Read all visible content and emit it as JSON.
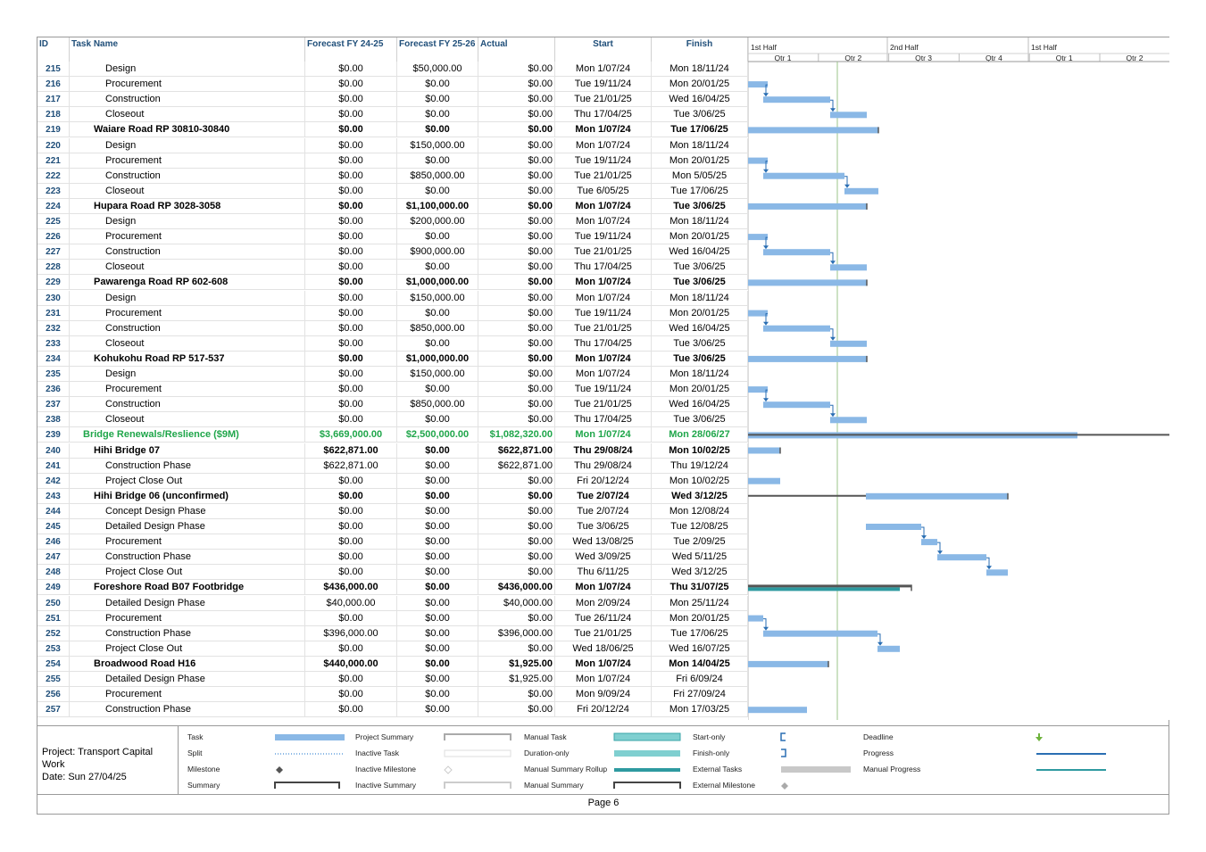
{
  "columns": {
    "id": "ID",
    "name": "Task Name",
    "f1": "Forecast FY 24-25",
    "f2": "Forecast FY 25-26",
    "actual": "Actual",
    "start": "Start",
    "finish": "Finish"
  },
  "timescale": {
    "tier1": [
      "1st Half",
      "2nd Half",
      "1st Half"
    ],
    "tier2": [
      "Qtr 1",
      "Qtr 2",
      "Qtr 3",
      "Qtr 4",
      "Qtr 1",
      "Qtr 2"
    ]
  },
  "rows": [
    {
      "id": "215",
      "name": "Design",
      "level": 2,
      "f1": "$0.00",
      "f2": "$50,000.00",
      "actual": "$0.00",
      "start": "Mon 1/07/24",
      "finish": "Mon 18/11/24"
    },
    {
      "id": "216",
      "name": "Procurement",
      "level": 2,
      "f1": "$0.00",
      "f2": "$0.00",
      "actual": "$0.00",
      "start": "Tue 19/11/24",
      "finish": "Mon 20/01/25"
    },
    {
      "id": "217",
      "name": "Construction",
      "level": 2,
      "f1": "$0.00",
      "f2": "$0.00",
      "actual": "$0.00",
      "start": "Tue 21/01/25",
      "finish": "Wed 16/04/25"
    },
    {
      "id": "218",
      "name": "Closeout",
      "level": 2,
      "f1": "$0.00",
      "f2": "$0.00",
      "actual": "$0.00",
      "start": "Thu 17/04/25",
      "finish": "Tue 3/06/25"
    },
    {
      "id": "219",
      "name": "Waiare Road RP 30810-30840",
      "level": 1,
      "f1": "$0.00",
      "f2": "$0.00",
      "actual": "$0.00",
      "start": "Mon 1/07/24",
      "finish": "Tue 17/06/25"
    },
    {
      "id": "220",
      "name": "Design",
      "level": 2,
      "f1": "$0.00",
      "f2": "$150,000.00",
      "actual": "$0.00",
      "start": "Mon 1/07/24",
      "finish": "Mon 18/11/24"
    },
    {
      "id": "221",
      "name": "Procurement",
      "level": 2,
      "f1": "$0.00",
      "f2": "$0.00",
      "actual": "$0.00",
      "start": "Tue 19/11/24",
      "finish": "Mon 20/01/25"
    },
    {
      "id": "222",
      "name": "Construction",
      "level": 2,
      "f1": "$0.00",
      "f2": "$850,000.00",
      "actual": "$0.00",
      "start": "Tue 21/01/25",
      "finish": "Mon 5/05/25"
    },
    {
      "id": "223",
      "name": "Closeout",
      "level": 2,
      "f1": "$0.00",
      "f2": "$0.00",
      "actual": "$0.00",
      "start": "Tue 6/05/25",
      "finish": "Tue 17/06/25"
    },
    {
      "id": "224",
      "name": "Hupara Road RP 3028-3058",
      "level": 1,
      "f1": "$0.00",
      "f2": "$1,100,000.00",
      "actual": "$0.00",
      "start": "Mon 1/07/24",
      "finish": "Tue 3/06/25"
    },
    {
      "id": "225",
      "name": "Design",
      "level": 2,
      "f1": "$0.00",
      "f2": "$200,000.00",
      "actual": "$0.00",
      "start": "Mon 1/07/24",
      "finish": "Mon 18/11/24"
    },
    {
      "id": "226",
      "name": "Procurement",
      "level": 2,
      "f1": "$0.00",
      "f2": "$0.00",
      "actual": "$0.00",
      "start": "Tue 19/11/24",
      "finish": "Mon 20/01/25"
    },
    {
      "id": "227",
      "name": "Construction",
      "level": 2,
      "f1": "$0.00",
      "f2": "$900,000.00",
      "actual": "$0.00",
      "start": "Tue 21/01/25",
      "finish": "Wed 16/04/25"
    },
    {
      "id": "228",
      "name": "Closeout",
      "level": 2,
      "f1": "$0.00",
      "f2": "$0.00",
      "actual": "$0.00",
      "start": "Thu 17/04/25",
      "finish": "Tue 3/06/25"
    },
    {
      "id": "229",
      "name": "Pawarenga Road RP 602-608",
      "level": 1,
      "f1": "$0.00",
      "f2": "$1,000,000.00",
      "actual": "$0.00",
      "start": "Mon 1/07/24",
      "finish": "Tue 3/06/25"
    },
    {
      "id": "230",
      "name": "Design",
      "level": 2,
      "f1": "$0.00",
      "f2": "$150,000.00",
      "actual": "$0.00",
      "start": "Mon 1/07/24",
      "finish": "Mon 18/11/24"
    },
    {
      "id": "231",
      "name": "Procurement",
      "level": 2,
      "f1": "$0.00",
      "f2": "$0.00",
      "actual": "$0.00",
      "start": "Tue 19/11/24",
      "finish": "Mon 20/01/25"
    },
    {
      "id": "232",
      "name": "Construction",
      "level": 2,
      "f1": "$0.00",
      "f2": "$850,000.00",
      "actual": "$0.00",
      "start": "Tue 21/01/25",
      "finish": "Wed 16/04/25"
    },
    {
      "id": "233",
      "name": "Closeout",
      "level": 2,
      "f1": "$0.00",
      "f2": "$0.00",
      "actual": "$0.00",
      "start": "Thu 17/04/25",
      "finish": "Tue 3/06/25"
    },
    {
      "id": "234",
      "name": "Kohukohu Road RP 517-537",
      "level": 1,
      "f1": "$0.00",
      "f2": "$1,000,000.00",
      "actual": "$0.00",
      "start": "Mon 1/07/24",
      "finish": "Tue 3/06/25"
    },
    {
      "id": "235",
      "name": "Design",
      "level": 2,
      "f1": "$0.00",
      "f2": "$150,000.00",
      "actual": "$0.00",
      "start": "Mon 1/07/24",
      "finish": "Mon 18/11/24"
    },
    {
      "id": "236",
      "name": "Procurement",
      "level": 2,
      "f1": "$0.00",
      "f2": "$0.00",
      "actual": "$0.00",
      "start": "Tue 19/11/24",
      "finish": "Mon 20/01/25"
    },
    {
      "id": "237",
      "name": "Construction",
      "level": 2,
      "f1": "$0.00",
      "f2": "$850,000.00",
      "actual": "$0.00",
      "start": "Tue 21/01/25",
      "finish": "Wed 16/04/25"
    },
    {
      "id": "238",
      "name": "Closeout",
      "level": 2,
      "f1": "$0.00",
      "f2": "$0.00",
      "actual": "$0.00",
      "start": "Thu 17/04/25",
      "finish": "Tue 3/06/25"
    },
    {
      "id": "239",
      "name": "Bridge Renewals/Reslience ($9M)",
      "level": 0,
      "f1": "$3,669,000.00",
      "f2": "$2,500,000.00",
      "actual": "$1,082,320.00",
      "start": "Mon 1/07/24",
      "finish": "Mon 28/06/27"
    },
    {
      "id": "240",
      "name": "Hihi Bridge 07",
      "level": 1,
      "f1": "$622,871.00",
      "f2": "$0.00",
      "actual": "$622,871.00",
      "start": "Thu 29/08/24",
      "finish": "Mon 10/02/25"
    },
    {
      "id": "241",
      "name": "Construction Phase",
      "level": 2,
      "f1": "$622,871.00",
      "f2": "$0.00",
      "actual": "$622,871.00",
      "start": "Thu 29/08/24",
      "finish": "Thu 19/12/24"
    },
    {
      "id": "242",
      "name": "Project Close Out",
      "level": 2,
      "f1": "$0.00",
      "f2": "$0.00",
      "actual": "$0.00",
      "start": "Fri 20/12/24",
      "finish": "Mon 10/02/25"
    },
    {
      "id": "243",
      "name": "Hihi Bridge 06 (unconfirmed)",
      "level": 1,
      "f1": "$0.00",
      "f2": "$0.00",
      "actual": "$0.00",
      "start": "Tue 2/07/24",
      "finish": "Wed 3/12/25"
    },
    {
      "id": "244",
      "name": "Concept Design Phase",
      "level": 2,
      "f1": "$0.00",
      "f2": "$0.00",
      "actual": "$0.00",
      "start": "Tue 2/07/24",
      "finish": "Mon 12/08/24"
    },
    {
      "id": "245",
      "name": "Detailed Design Phase",
      "level": 2,
      "f1": "$0.00",
      "f2": "$0.00",
      "actual": "$0.00",
      "start": "Tue 3/06/25",
      "finish": "Tue 12/08/25"
    },
    {
      "id": "246",
      "name": "Procurement",
      "level": 2,
      "f1": "$0.00",
      "f2": "$0.00",
      "actual": "$0.00",
      "start": "Wed 13/08/25",
      "finish": "Tue 2/09/25"
    },
    {
      "id": "247",
      "name": "Construction Phase",
      "level": 2,
      "f1": "$0.00",
      "f2": "$0.00",
      "actual": "$0.00",
      "start": "Wed 3/09/25",
      "finish": "Wed 5/11/25"
    },
    {
      "id": "248",
      "name": "Project Close Out",
      "level": 2,
      "f1": "$0.00",
      "f2": "$0.00",
      "actual": "$0.00",
      "start": "Thu 6/11/25",
      "finish": "Wed 3/12/25"
    },
    {
      "id": "249",
      "name": "Foreshore Road B07 Footbridge",
      "level": 1,
      "f1": "$436,000.00",
      "f2": "$0.00",
      "actual": "$436,000.00",
      "start": "Mon 1/07/24",
      "finish": "Thu 31/07/25"
    },
    {
      "id": "250",
      "name": "Detailed Design Phase",
      "level": 2,
      "f1": "$40,000.00",
      "f2": "$0.00",
      "actual": "$40,000.00",
      "start": "Mon 2/09/24",
      "finish": "Mon 25/11/24"
    },
    {
      "id": "251",
      "name": "Procurement",
      "level": 2,
      "f1": "$0.00",
      "f2": "$0.00",
      "actual": "$0.00",
      "start": "Tue 26/11/24",
      "finish": "Mon 20/01/25"
    },
    {
      "id": "252",
      "name": "Construction Phase",
      "level": 2,
      "f1": "$396,000.00",
      "f2": "$0.00",
      "actual": "$396,000.00",
      "start": "Tue 21/01/25",
      "finish": "Tue 17/06/25"
    },
    {
      "id": "253",
      "name": "Project Close Out",
      "level": 2,
      "f1": "$0.00",
      "f2": "$0.00",
      "actual": "$0.00",
      "start": "Wed 18/06/25",
      "finish": "Wed 16/07/25"
    },
    {
      "id": "254",
      "name": "Broadwood Road H16",
      "level": 1,
      "f1": "$440,000.00",
      "f2": "$0.00",
      "actual": "$1,925.00",
      "start": "Mon 1/07/24",
      "finish": "Mon 14/04/25"
    },
    {
      "id": "255",
      "name": "Detailed Design Phase",
      "level": 2,
      "f1": "$0.00",
      "f2": "$0.00",
      "actual": "$1,925.00",
      "start": "Mon 1/07/24",
      "finish": "Fri 6/09/24"
    },
    {
      "id": "256",
      "name": "Procurement",
      "level": 2,
      "f1": "$0.00",
      "f2": "$0.00",
      "actual": "$0.00",
      "start": "Mon 9/09/24",
      "finish": "Fri 27/09/24"
    },
    {
      "id": "257",
      "name": "Construction Phase",
      "level": 2,
      "f1": "$0.00",
      "f2": "$0.00",
      "actual": "$0.00",
      "start": "Fri 20/12/24",
      "finish": "Mon 17/03/25"
    }
  ],
  "gantt_bars": [
    {
      "row": 0,
      "type": "none"
    },
    {
      "row": 1,
      "type": "task",
      "a": 0,
      "b": 22
    },
    {
      "row": 2,
      "type": "task",
      "a": 17,
      "b": 92
    },
    {
      "row": 3,
      "type": "task",
      "a": 92,
      "b": 133
    },
    {
      "row": 4,
      "type": "summary",
      "a": 0,
      "b": 146
    },
    {
      "row": 5,
      "type": "none"
    },
    {
      "row": 6,
      "type": "task",
      "a": 0,
      "b": 22
    },
    {
      "row": 7,
      "type": "task",
      "a": 17,
      "b": 108
    },
    {
      "row": 8,
      "type": "task",
      "a": 108,
      "b": 146
    },
    {
      "row": 9,
      "type": "summary",
      "a": 0,
      "b": 133
    },
    {
      "row": 10,
      "type": "none"
    },
    {
      "row": 11,
      "type": "task",
      "a": 0,
      "b": 22
    },
    {
      "row": 12,
      "type": "task",
      "a": 17,
      "b": 92
    },
    {
      "row": 13,
      "type": "task",
      "a": 92,
      "b": 133
    },
    {
      "row": 14,
      "type": "summary",
      "a": 0,
      "b": 133
    },
    {
      "row": 15,
      "type": "none"
    },
    {
      "row": 16,
      "type": "task",
      "a": 0,
      "b": 22
    },
    {
      "row": 17,
      "type": "task",
      "a": 17,
      "b": 92
    },
    {
      "row": 18,
      "type": "task",
      "a": 92,
      "b": 133
    },
    {
      "row": 19,
      "type": "summary",
      "a": 0,
      "b": 133
    },
    {
      "row": 20,
      "type": "none"
    },
    {
      "row": 21,
      "type": "task",
      "a": 0,
      "b": 22
    },
    {
      "row": 22,
      "type": "task",
      "a": 17,
      "b": 92
    },
    {
      "row": 23,
      "type": "task",
      "a": 92,
      "b": 133
    },
    {
      "row": 24,
      "type": "rollup",
      "a": 0,
      "b": 472,
      "c": 369
    },
    {
      "row": 25,
      "type": "summary",
      "a": 0,
      "b": 36
    },
    {
      "row": 26,
      "type": "none"
    },
    {
      "row": 27,
      "type": "task",
      "a": 0,
      "b": 36
    },
    {
      "row": 28,
      "type": "hsummary",
      "a": 0,
      "b": 291,
      "c": 132
    },
    {
      "row": 29,
      "type": "none"
    },
    {
      "row": 30,
      "type": "task",
      "a": 132,
      "b": 194
    },
    {
      "row": 31,
      "type": "task",
      "a": 194,
      "b": 212
    },
    {
      "row": 32,
      "type": "task",
      "a": 212,
      "b": 267
    },
    {
      "row": 33,
      "type": "task",
      "a": 267,
      "b": 291
    },
    {
      "row": 34,
      "type": "progress",
      "a": 0,
      "b": 183,
      "c": 170
    },
    {
      "row": 35,
      "type": "none"
    },
    {
      "row": 36,
      "type": "task",
      "a": 0,
      "b": 17
    },
    {
      "row": 37,
      "type": "task",
      "a": 17,
      "b": 145
    },
    {
      "row": 38,
      "type": "task",
      "a": 145,
      "b": 170
    },
    {
      "row": 39,
      "type": "summary",
      "a": 0,
      "b": 90
    },
    {
      "row": 40,
      "type": "none"
    },
    {
      "row": 41,
      "type": "none"
    },
    {
      "row": 42,
      "type": "task",
      "a": 0,
      "b": 66
    }
  ],
  "legend": {
    "project": "Project: Transport Capital Work",
    "date": "Date: Sun 27/04/25",
    "items": [
      "Task",
      "Split",
      "Milestone",
      "Summary",
      "Project Summary",
      "Inactive Task",
      "Inactive Milestone",
      "Inactive Summary",
      "Manual Task",
      "Duration-only",
      "Manual Summary Rollup",
      "Manual Summary",
      "Start-only",
      "Finish-only",
      "External Tasks",
      "External Milestone",
      "Deadline",
      "Progress",
      "Manual Progress"
    ]
  },
  "footer": {
    "page": "Page 6"
  },
  "colors": {
    "task": "#8ab8e6",
    "summary": "#555555",
    "accent": "#1f4e79",
    "green": "#1fa64a",
    "progress": "#2e9aa0"
  }
}
